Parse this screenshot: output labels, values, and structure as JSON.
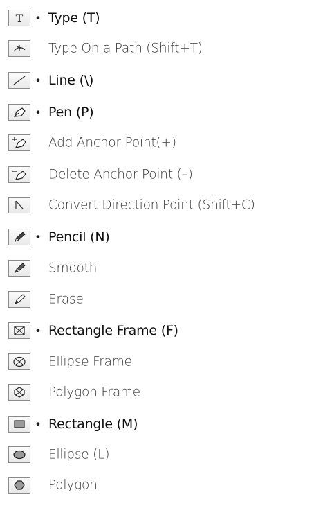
{
  "tools": [
    {
      "label": "Type (T)",
      "primary": true,
      "icon": "type-icon"
    },
    {
      "label": "Type On a Path (Shift+T)",
      "primary": false,
      "icon": "type-on-path-icon"
    },
    {
      "label": "Line (\\)",
      "primary": true,
      "icon": "line-icon"
    },
    {
      "label": "Pen (P)",
      "primary": true,
      "icon": "pen-icon"
    },
    {
      "label": "Add Anchor Point(+)",
      "primary": false,
      "icon": "add-anchor-point-icon"
    },
    {
      "label": "Delete Anchor Point (–)",
      "primary": false,
      "icon": "delete-anchor-point-icon"
    },
    {
      "label": "Convert Direction Point (Shift+C)",
      "primary": false,
      "icon": "convert-direction-point-icon"
    },
    {
      "label": "Pencil (N)",
      "primary": true,
      "icon": "pencil-icon"
    },
    {
      "label": "Smooth",
      "primary": false,
      "icon": "smooth-icon"
    },
    {
      "label": "Erase",
      "primary": false,
      "icon": "erase-icon"
    },
    {
      "label": "Rectangle Frame (F)",
      "primary": true,
      "icon": "rectangle-frame-icon"
    },
    {
      "label": "Ellipse Frame",
      "primary": false,
      "icon": "ellipse-frame-icon"
    },
    {
      "label": "Polygon Frame",
      "primary": false,
      "icon": "polygon-frame-icon"
    },
    {
      "label": "Rectangle (M)",
      "primary": true,
      "icon": "rectangle-icon"
    },
    {
      "label": "Ellipse (L)",
      "primary": false,
      "icon": "ellipse-icon"
    },
    {
      "label": "Polygon",
      "primary": false,
      "icon": "polygon-icon"
    }
  ],
  "bullet_glyph": "•"
}
